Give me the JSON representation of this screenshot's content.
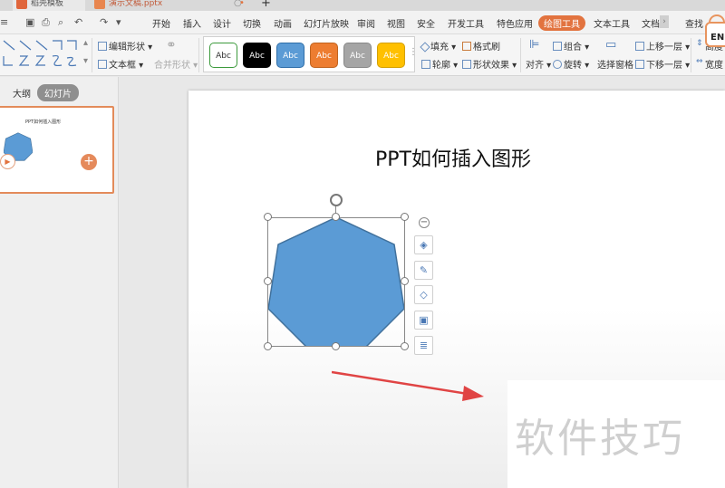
{
  "titlebar": {
    "tabs": [
      {
        "label": "稻壳模板"
      },
      {
        "label": "演示文稿.pptx"
      }
    ],
    "add_label": "+"
  },
  "quick_access": {
    "items": [
      "≡",
      "▣",
      "⎙",
      "⌕",
      "↶",
      "↷",
      "▾"
    ]
  },
  "menu": {
    "items": [
      "开始",
      "插入",
      "设计",
      "切换",
      "动画",
      "幻灯片放映",
      "审阅",
      "视图",
      "安全",
      "开发工具",
      "特色应用",
      "绘图工具",
      "文本工具",
      "文档"
    ],
    "active_index": 11,
    "search_label": "查找"
  },
  "ime_badge": "EN",
  "ribbon": {
    "edit_shape": "编辑形状",
    "text_box": "文本框",
    "merge_shapes": "合并形状",
    "style_swatches": [
      {
        "label": "Abc",
        "bg": "#ffffff",
        "fg": "#333333",
        "border": "#3c9a3c"
      },
      {
        "label": "Abc",
        "bg": "#000000",
        "fg": "#ffffff",
        "border": "#000000"
      },
      {
        "label": "Abc",
        "bg": "#5b9bd5",
        "fg": "#ffffff",
        "border": "#2f6ea8"
      },
      {
        "label": "Abc",
        "bg": "#ed7d31",
        "fg": "#ffffff",
        "border": "#c0631f"
      },
      {
        "label": "Abc",
        "bg": "#a5a5a5",
        "fg": "#ffffff",
        "border": "#888888"
      },
      {
        "label": "Abc",
        "bg": "#ffc000",
        "fg": "#ffffff",
        "border": "#d4a000"
      }
    ],
    "fill": "填充",
    "outline": "轮廓",
    "format_painter": "格式刷",
    "shape_effects": "形状效果",
    "align": "对齐",
    "group": "组合",
    "rotate": "旋转",
    "selection_pane": "选择窗格",
    "bring_forward": "上移一层",
    "send_backward": "下移一层",
    "height": "高度",
    "width": "宽度"
  },
  "left_pane": {
    "outline_tab": "大纲",
    "slides_tab": "幻灯片",
    "thumb_title": "PPT如何插入图形"
  },
  "slide": {
    "title": "PPT如何插入图形",
    "shape_color": "#5b9bd5",
    "watermark": "软件技巧"
  },
  "colors": {
    "accent": "#e2733f",
    "arrow": "#e04444"
  }
}
